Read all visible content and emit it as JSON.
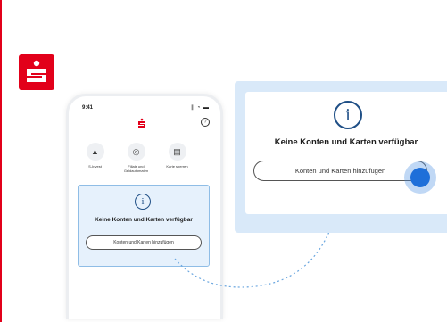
{
  "phone": {
    "time": "9:41",
    "status_icons": "∥ ◔ ▬",
    "actions": [
      {
        "label": "S-Invest",
        "icon": "invest-icon",
        "glyph": "▲"
      },
      {
        "label": "Filiale und Geldautomaten",
        "icon": "branch-atm-icon",
        "glyph": "◎"
      },
      {
        "label": "Karte sperren",
        "icon": "card-lock-icon",
        "glyph": "▤"
      }
    ],
    "card": {
      "info_glyph": "i",
      "title": "Keine Konten und Karten verfügbar",
      "button": "Konten und Karten hinzufügen"
    }
  },
  "zoom_card": {
    "info_glyph": "i",
    "title": "Keine Konten und Karten verfügbar",
    "button": "Konten und Karten hinzufügen"
  },
  "colors": {
    "brand_red": "#e2001a",
    "accent_blue": "#1e6fd9",
    "card_bg": "#d9e9f9",
    "info_blue": "#1f4f86"
  }
}
